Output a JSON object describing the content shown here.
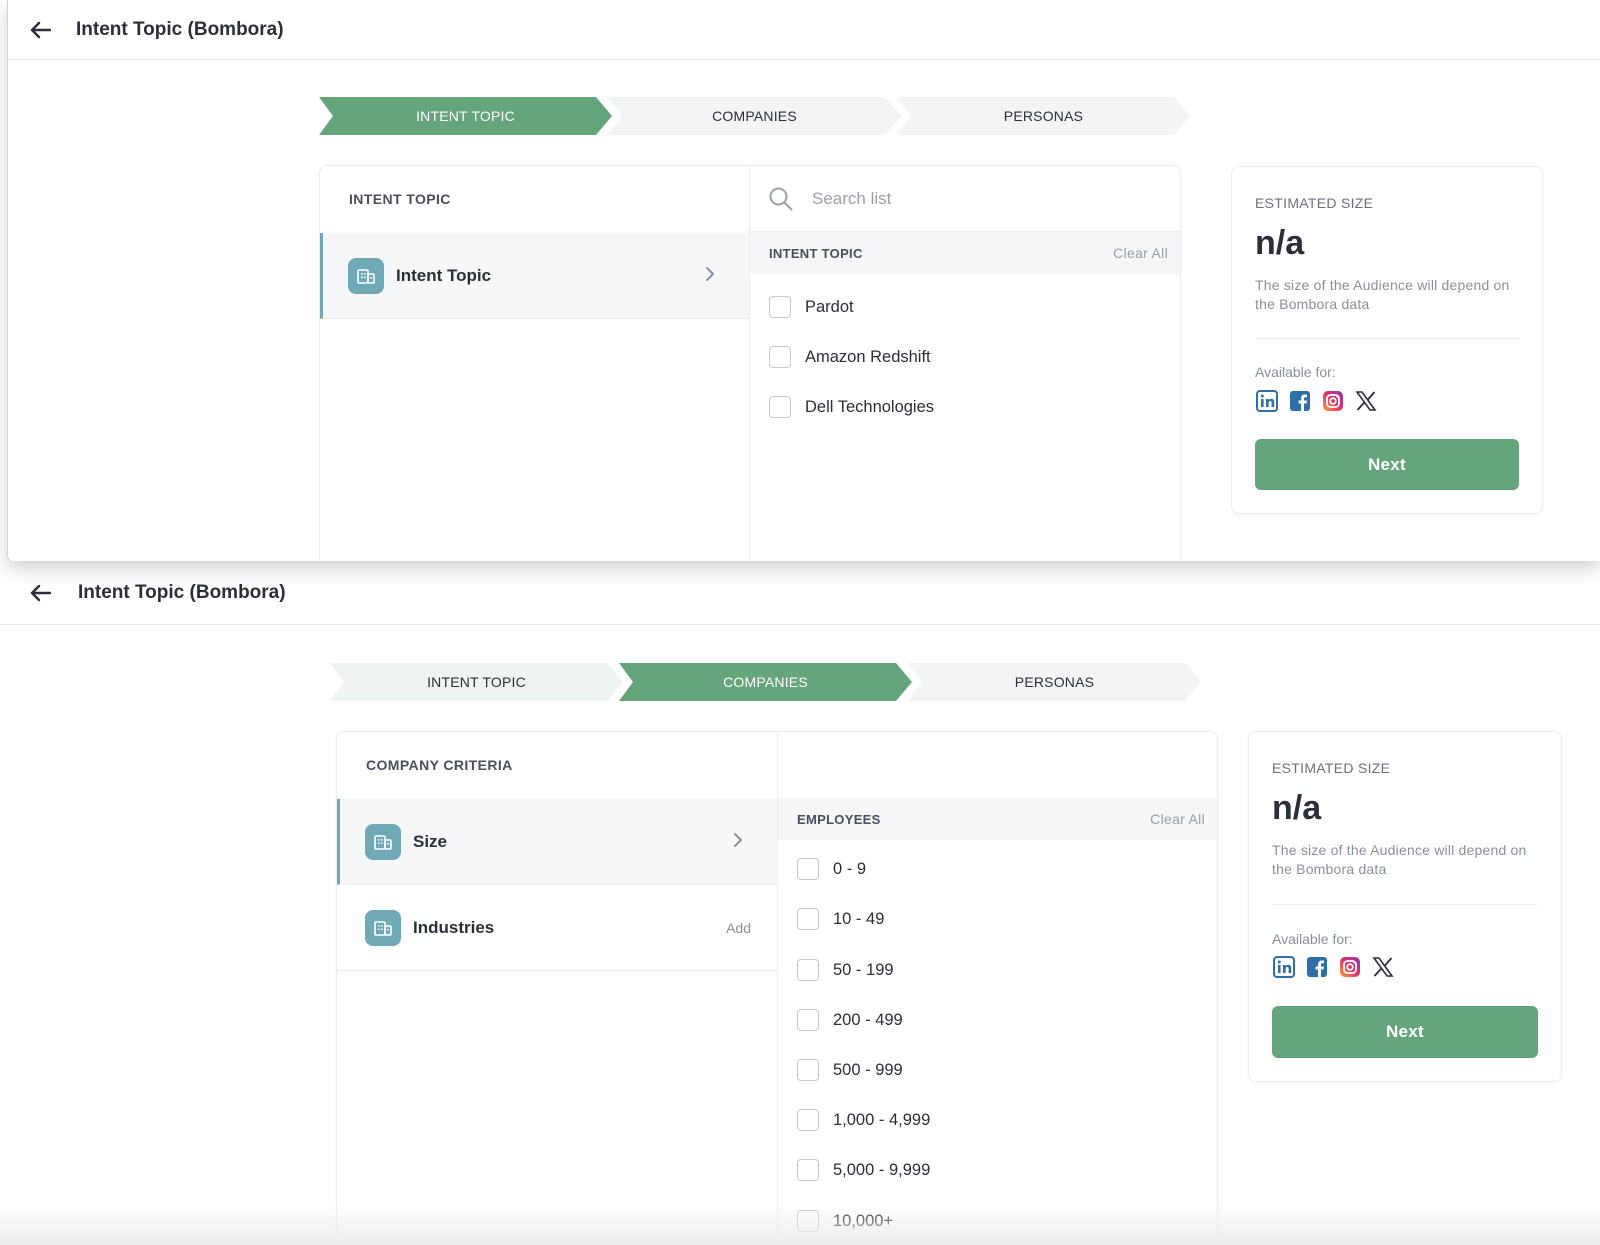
{
  "colors": {
    "accent_green": "#65a57c",
    "step_inactive": "#f2f4f6",
    "icon_teal": "#6fa9b5"
  },
  "screen_top": {
    "header": {
      "title": "Intent Topic (Bombora)",
      "back_icon": "arrow-left-icon"
    },
    "steps": [
      {
        "label": "INTENT TOPIC",
        "state": "active"
      },
      {
        "label": "COMPANIES",
        "state": "inactive"
      },
      {
        "label": "PERSONAS",
        "state": "inactive"
      }
    ],
    "left_panel": {
      "title": "INTENT TOPIC",
      "items": [
        {
          "label": "Intent Topic",
          "icon": "building-icon",
          "selected": true
        }
      ]
    },
    "right_panel": {
      "search_placeholder": "Search list",
      "list_header": "INTENT TOPIC",
      "clear_all": "Clear All",
      "options": [
        "Pardot",
        "Amazon Redshift",
        "Dell Technologies"
      ]
    },
    "estimate": {
      "title": "ESTIMATED SIZE",
      "value": "n/a",
      "description": "The size of the Audience will depend on the Bombora data",
      "available_label": "Available for:",
      "platforms": [
        "linkedin-icon",
        "facebook-icon",
        "instagram-icon",
        "x-icon"
      ],
      "next_label": "Next"
    }
  },
  "screen_bottom": {
    "header": {
      "title": "Intent Topic (Bombora)",
      "back_icon": "arrow-left-icon"
    },
    "steps": [
      {
        "label": "INTENT TOPIC",
        "state": "completed"
      },
      {
        "label": "COMPANIES",
        "state": "active"
      },
      {
        "label": "PERSONAS",
        "state": "inactive"
      }
    ],
    "left_panel": {
      "title": "COMPANY CRITERIA",
      "items": [
        {
          "label": "Size",
          "icon": "building-icon",
          "selected": true
        },
        {
          "label": "Industries",
          "icon": "building-icon",
          "selected": false,
          "action": "Add"
        }
      ]
    },
    "right_panel": {
      "list_header": "EMPLOYEES",
      "clear_all": "Clear All",
      "options": [
        "0 - 9",
        "10 - 49",
        "50 - 199",
        "200 - 499",
        "500 - 999",
        "1,000 - 4,999",
        "5,000 - 9,999",
        "10,000+"
      ]
    },
    "estimate": {
      "title": "ESTIMATED SIZE",
      "value": "n/a",
      "description": "The size of the Audience will depend on the Bombora data",
      "available_label": "Available for:",
      "platforms": [
        "linkedin-icon",
        "facebook-icon",
        "instagram-icon",
        "x-icon"
      ],
      "next_label": "Next"
    }
  }
}
